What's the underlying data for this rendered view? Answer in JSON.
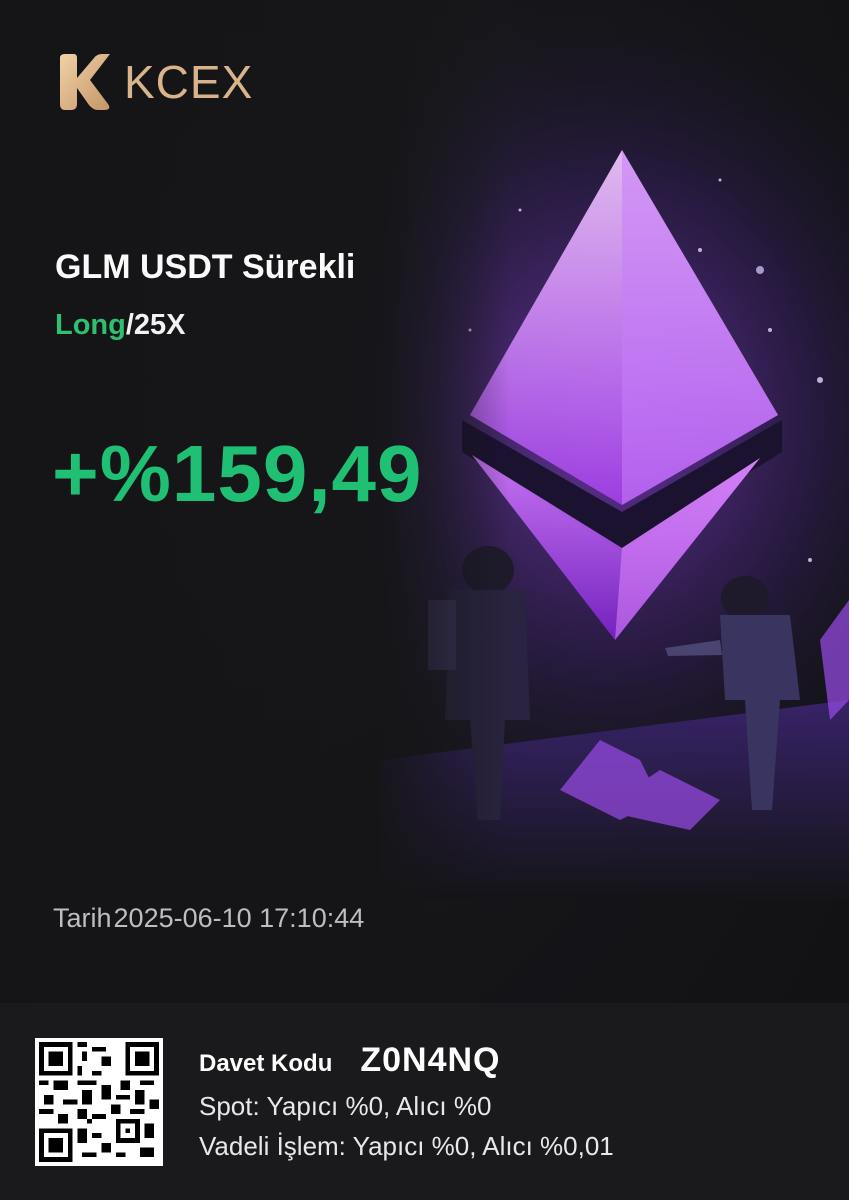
{
  "brand": {
    "name": "KCEX",
    "logo_icon": "kcex-k-logo-icon",
    "color": "#d9b48a"
  },
  "trade": {
    "pair": "GLM USDT Sürekli",
    "side": "Long",
    "separator": "/",
    "leverage": "25X",
    "pnl": "+%159,49"
  },
  "date": {
    "label": "Tarih",
    "value": "2025-06-10 17:10:44"
  },
  "footer": {
    "qr_icon": "qr-code-icon",
    "invite_label": "Davet Kodu",
    "invite_code": "Z0N4NQ",
    "spot_fees": "Spot: Yapıcı %0, Alıcı %0",
    "futures_fees": "Vadeli İşlem: Yapıcı %0, Alıcı %0,01"
  },
  "colors": {
    "positive": "#1fbf74",
    "background": "#121214",
    "footer": "#1a1a1c",
    "accent_purple": "#b35cff"
  }
}
